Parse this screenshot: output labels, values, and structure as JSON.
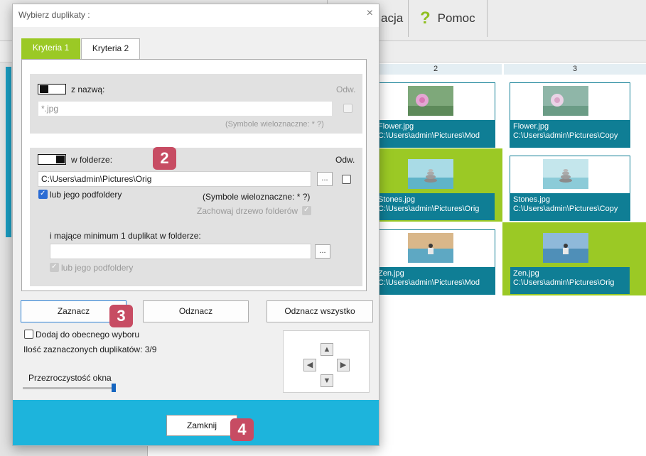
{
  "app": {
    "toolbar": {
      "partial_label": "acja",
      "help_label": "Pomoc"
    },
    "columns": [
      "2",
      "3"
    ],
    "cards": [
      {
        "name": "Flower.jpg",
        "path": "C:\\Users\\admin\\Pictures\\Mod",
        "selected": false
      },
      {
        "name": "Flower.jpg",
        "path": "C:\\Users\\admin\\Pictures\\Copy",
        "selected": false
      },
      {
        "name": "Stones.jpg",
        "path": "C:\\Users\\admin\\Pictures\\Orig",
        "selected": true
      },
      {
        "name": "Stones.jpg",
        "path": "C:\\Users\\admin\\Pictures\\Copy",
        "selected": false
      },
      {
        "name": "Zen.jpg",
        "path": "C:\\Users\\admin\\Pictures\\Mod",
        "selected": false
      },
      {
        "name": "Zen.jpg",
        "path": "C:\\Users\\admin\\Pictures\\Orig",
        "selected": true
      }
    ]
  },
  "dialog": {
    "title": "Wybierz duplikaty :",
    "tabs": [
      "Kryteria 1",
      "Kryteria 2"
    ],
    "by_name": {
      "label": "z nazwą:",
      "odw_label": "Odw.",
      "value": "*.jpg",
      "hint": "(Symbole wieloznaczne: * ?)"
    },
    "in_folder": {
      "label": "w folderze:",
      "odw_label": "Odw.",
      "value": "C:\\Users\\admin\\Pictures\\Orig",
      "browse_label": "...",
      "subfolders_label": "lub jego podfoldery",
      "hint": "(Symbole wieloznaczne: * ?)",
      "keep_tree_label": "Zachowaj drzewo folderów",
      "min_dup_label": "i mające minimum 1 duplikat w folderze:",
      "min_dup_value": "",
      "min_browse_label": "...",
      "min_subfolders_label": "lub jego podfoldery"
    },
    "buttons": {
      "select": "Zaznacz",
      "deselect": "Odznacz",
      "deselect_all": "Odznacz wszystko",
      "close": "Zamknij"
    },
    "add_to_selection_label": "Dodaj do obecnego wyboru",
    "selected_count_text": "Ilość zaznaczonych duplikatów: 3/9",
    "opacity_label": "Przezroczystość okna",
    "opacity_value": 1.0,
    "close_icon": "×",
    "arrows": {
      "up": "▲",
      "left": "◀",
      "right": "▶",
      "down": "▼"
    }
  },
  "badges": [
    "2",
    "3",
    "4"
  ],
  "colors": {
    "accent_green": "#9bc925",
    "teal": "#0f7e95",
    "footer_blue": "#1db4dc",
    "badge": "#c74c63"
  }
}
